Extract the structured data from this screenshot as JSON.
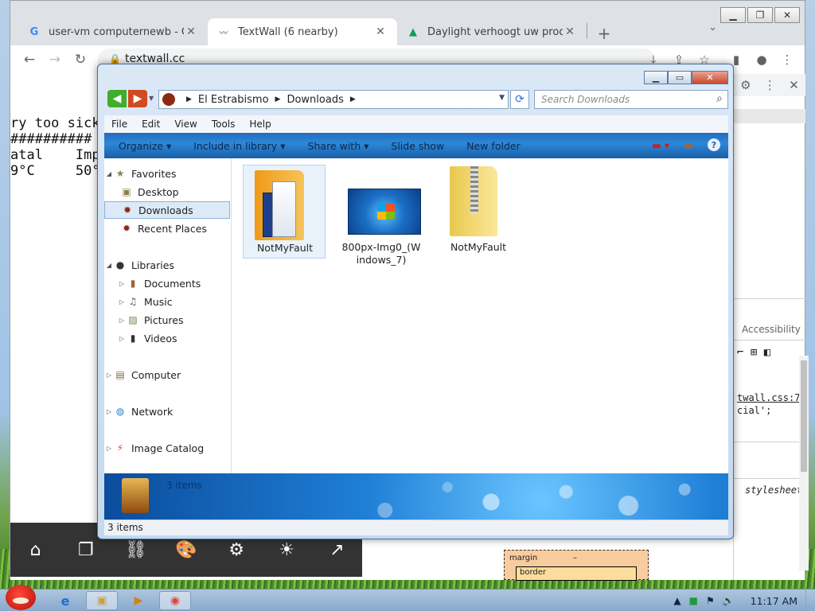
{
  "browser": {
    "tabs": [
      {
        "title": "user-vm computernewb - Goo",
        "favicon": "google-icon",
        "active": false
      },
      {
        "title": "TextWall (6 nearby)",
        "favicon": "textwall-icon",
        "active": true
      },
      {
        "title": "Daylight verhoogt uw product",
        "favicon": "drive-icon",
        "active": false
      }
    ],
    "url": "textwall.cc"
  },
  "page": {
    "lines": [
      "ry too sick",
      "##########",
      "atal    Imp",
      "9°C     50°"
    ],
    "devtools": {
      "css_ref": "twall.css:7",
      "css_value": "cial';",
      "stylesheet": "stylesheet",
      "accessibility_tab": "Accessibility",
      "box_margin": "margin",
      "box_margin_value": "–",
      "box_border": "border"
    }
  },
  "explorer": {
    "breadcrumb": [
      "El Estrabismo",
      "Downloads"
    ],
    "search_placeholder": "Search Downloads",
    "menu": [
      "File",
      "Edit",
      "View",
      "Tools",
      "Help"
    ],
    "commands": [
      "Organize",
      "Include in library",
      "Share with",
      "Slide show",
      "New folder"
    ],
    "nav": {
      "favorites": "Favorites",
      "desktop": "Desktop",
      "downloads": "Downloads",
      "recent": "Recent Places",
      "libraries": "Libraries",
      "documents": "Documents",
      "music": "Music",
      "pictures": "Pictures",
      "videos": "Videos",
      "computer": "Computer",
      "network": "Network",
      "catalog": "Image Catalog"
    },
    "files": [
      {
        "name": "NotMyFault",
        "type": "folder"
      },
      {
        "name": "800px-Img0_(Windows_7)",
        "line1": "800px-Img0_(W",
        "line2": "indows_7)",
        "type": "image"
      },
      {
        "name": "NotMyFault",
        "type": "zip"
      }
    ],
    "details_count": "3 items",
    "status": "3 items"
  },
  "taskbar": {
    "clock": "11:17 AM"
  }
}
